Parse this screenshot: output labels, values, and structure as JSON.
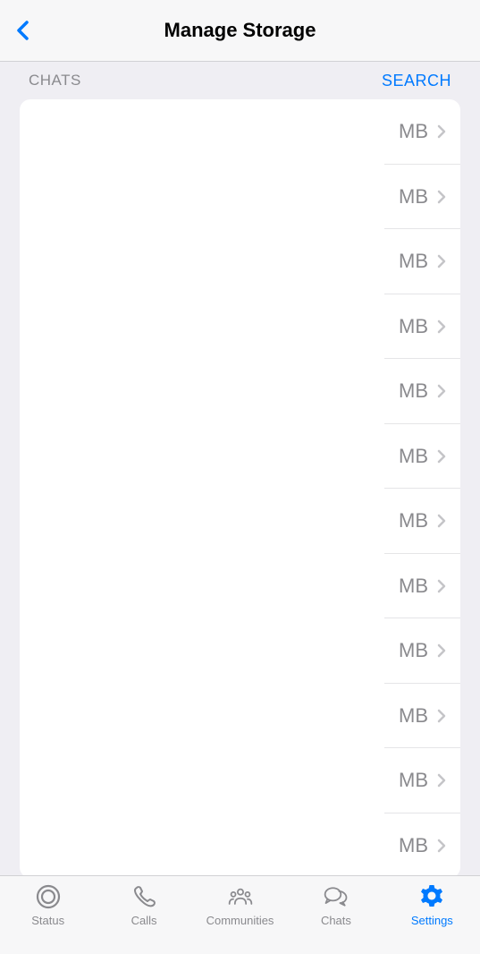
{
  "header": {
    "title": "Manage Storage"
  },
  "section": {
    "label": "CHATS",
    "search_label": "SEARCH"
  },
  "rows": [
    {
      "size": "MB"
    },
    {
      "size": "MB"
    },
    {
      "size": "MB"
    },
    {
      "size": "MB"
    },
    {
      "size": "MB"
    },
    {
      "size": "MB"
    },
    {
      "size": "MB"
    },
    {
      "size": "MB"
    },
    {
      "size": "MB"
    },
    {
      "size": "MB"
    },
    {
      "size": "MB"
    },
    {
      "size": "MB"
    }
  ],
  "tabs": {
    "status": "Status",
    "calls": "Calls",
    "communities": "Communities",
    "chats": "Chats",
    "settings": "Settings"
  }
}
